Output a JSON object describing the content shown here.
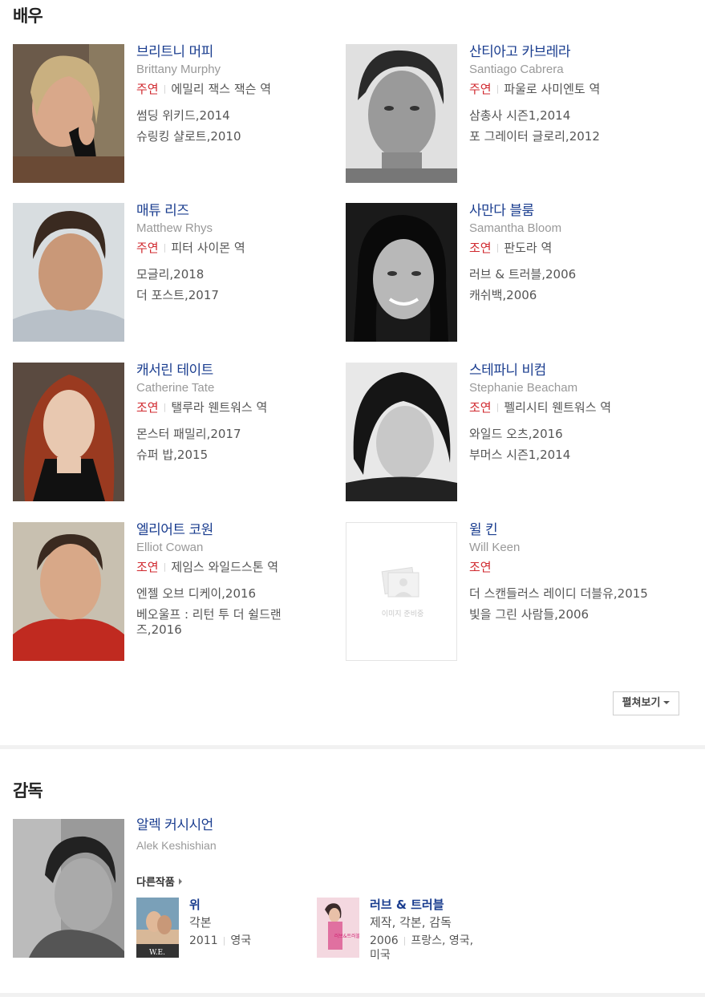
{
  "cast_section": {
    "title": "배우",
    "actors": [
      {
        "name_ko": "브리트니 머피",
        "name_en": "Brittany Murphy",
        "role_type": "주연",
        "role": "에밀리 잭스 잭슨 역",
        "works": [
          "썸딩 위키드,2014",
          "슈링킹 샬로트,2010"
        ]
      },
      {
        "name_ko": "산티아고 카브레라",
        "name_en": "Santiago Cabrera",
        "role_type": "주연",
        "role": "파울로 사미엔토 역",
        "works": [
          "삼총사 시즌1,2014",
          "포 그레이터 글로리,2012"
        ]
      },
      {
        "name_ko": "매튜 리즈",
        "name_en": "Matthew Rhys",
        "role_type": "주연",
        "role": "피터 사이몬 역",
        "works": [
          "모글리,2018",
          "더 포스트,2017"
        ]
      },
      {
        "name_ko": "사만다 블룸",
        "name_en": "Samantha Bloom",
        "role_type": "조연",
        "role": "판도라 역",
        "works": [
          "러브 & 트러블,2006",
          "캐쉬백,2006"
        ]
      },
      {
        "name_ko": "캐서린 테이트",
        "name_en": "Catherine Tate",
        "role_type": "조연",
        "role": "탤루라 웬트워스 역",
        "works": [
          "몬스터 패밀리,2017",
          "슈퍼 밥,2015"
        ]
      },
      {
        "name_ko": "스테파니 비컴",
        "name_en": "Stephanie Beacham",
        "role_type": "조연",
        "role": "펠리시티 웬트워스 역",
        "works": [
          "와일드 오츠,2016",
          "부머스 시즌1,2014"
        ]
      },
      {
        "name_ko": "엘리어트 코원",
        "name_en": "Elliot Cowan",
        "role_type": "조연",
        "role": "제임스 와일드스톤 역",
        "works": [
          "엔젤 오브 디케이,2016",
          "베오울프 : 리턴 투 더 쉴드랜즈,2016"
        ]
      },
      {
        "name_ko": "윌 킨",
        "name_en": "Will Keen",
        "role_type": "조연",
        "role": "",
        "works": [
          "더 스캔들러스 레이디 더블유,2015",
          "빛을 그린 사람들,2006"
        ],
        "no_image_text": "이미지 준비중"
      }
    ],
    "expand_label": "펼쳐보기"
  },
  "director_section": {
    "title": "감독",
    "name_ko": "알렉 커시시언",
    "name_en": "Alek Keshishian",
    "other_works_label": "다른작품",
    "works": [
      {
        "title": "위",
        "role": "각본",
        "year": "2011",
        "country": "영국",
        "poster_text": "W.E."
      },
      {
        "title": "러브 & 트러블",
        "role": "제작, 각본, 감독",
        "year": "2006",
        "country": "프랑스, 영국, 미국",
        "poster_text": "러브&트러블"
      }
    ]
  },
  "colors": {
    "name_link": "#1a3d8f",
    "role_type": "#d0292f",
    "english_name": "#999999"
  }
}
